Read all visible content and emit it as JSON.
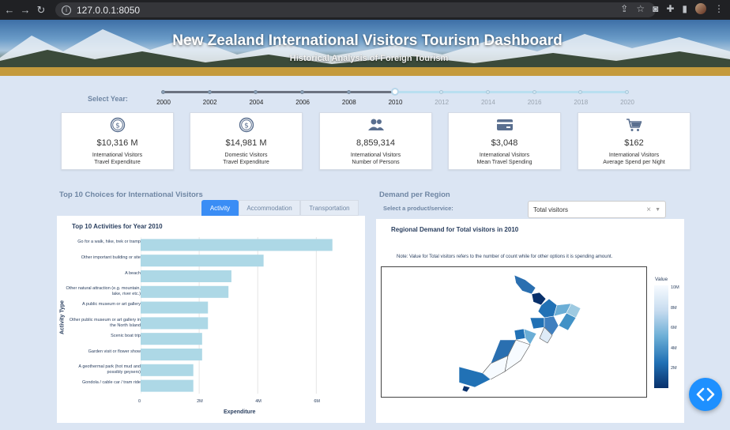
{
  "browser": {
    "url": "127.0.0.1:8050"
  },
  "header": {
    "title": "New Zealand International Visitors Tourism Dashboard",
    "subtitle": "Historical Analysis of Foreign Tourism"
  },
  "slider": {
    "label": "Select Year:",
    "marks": [
      "2000",
      "2002",
      "2004",
      "2006",
      "2008",
      "2010",
      "2012",
      "2014",
      "2016",
      "2018",
      "2020"
    ],
    "selected": "2010"
  },
  "kpis": [
    {
      "icon": "dollar-icon",
      "value": "$10,316 M",
      "line1": "International Visitors",
      "line2": "Travel Expenditure"
    },
    {
      "icon": "dollar-icon",
      "value": "$14,981 M",
      "line1": "Domestic Visitors",
      "line2": "Travel Expenditure"
    },
    {
      "icon": "people-icon",
      "value": "8,859,314",
      "line1": "International Visitors",
      "line2": "Number of Persons"
    },
    {
      "icon": "card-icon",
      "value": "$3,048",
      "line1": "International Visitors",
      "line2": "Mean Travel Spending"
    },
    {
      "icon": "cart-icon",
      "value": "$162",
      "line1": "International Visitors",
      "line2": "Average Spend per Night"
    }
  ],
  "left": {
    "section_title": "Top 10 Choices for International Visitors",
    "tabs": [
      "Activity",
      "Accommodation",
      "Transportation"
    ],
    "active_tab": "Activity"
  },
  "right": {
    "section_title": "Demand per Region",
    "select_label": "Select a product/service:",
    "select_value": "Total visitors",
    "select_clear": "×",
    "select_arrow": "▼",
    "map_title": "Regional Demand for Total visitors in 2010",
    "note": "Note: Value for Total visitors refers to the number of count while for other options it is spending amount.",
    "colorbar_title": "Value",
    "colorbar_ticks": [
      "10M",
      "8M",
      "6M",
      "4M",
      "2M"
    ],
    "colorscale": [
      "#f7fbff",
      "#c6dbef",
      "#6baed6",
      "#2171b5",
      "#08306b"
    ]
  },
  "chart_data": {
    "type": "bar",
    "orientation": "horizontal",
    "title": "Top 10 Activities for Year 2010",
    "xlabel": "Expenditure",
    "ylabel": "Activity Type",
    "xticks": [
      "0",
      "2M",
      "4M",
      "6M"
    ],
    "xlim": [
      0,
      6800000
    ],
    "color": "#add8e6",
    "categories": [
      "Go for a walk, hike, trek or tramp",
      "Other important building or site",
      "A beach",
      "Other natural attraction (e.g. mountain, lake, river etc.)",
      "A public museum or art gallery",
      "Other public museum or art gallery in the North Island",
      "Scenic boat trip",
      "Garden visit or flower show",
      "A geothermal park (hot mud and possibly geysers)",
      "Gondola / cable car / tram ride"
    ],
    "values": [
      6550000,
      4200000,
      3100000,
      3000000,
      2300000,
      2300000,
      2100000,
      2100000,
      1800000,
      1800000
    ]
  }
}
